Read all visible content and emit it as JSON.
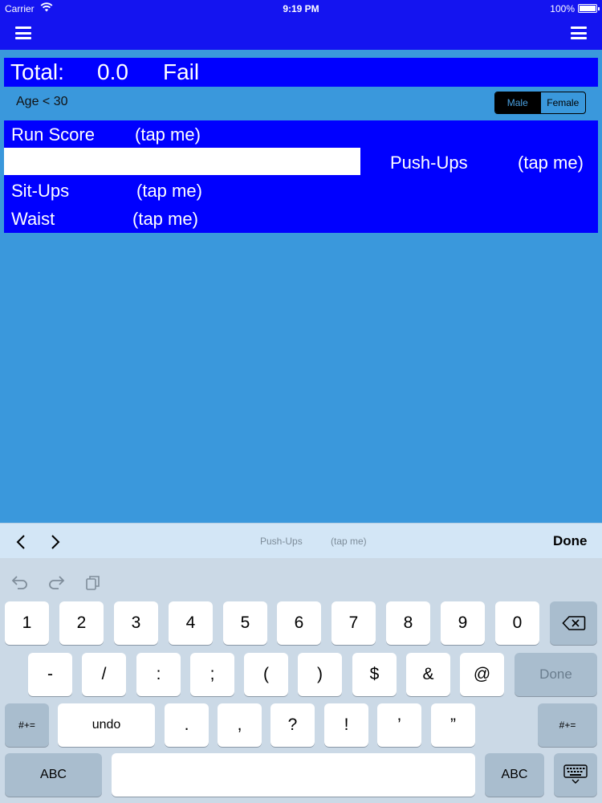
{
  "status_bar": {
    "carrier": "Carrier",
    "time": "9:19 PM",
    "battery": "100%",
    "icons": [
      "wifi-icon",
      "battery-icon"
    ]
  },
  "nav": {
    "left_icon": "hamburger-menu-icon",
    "right_icon": "hamburger-menu-icon"
  },
  "summary": {
    "total_label": "Total:",
    "total_value": "0.0",
    "result": "Fail",
    "age_group": "Age < 30"
  },
  "gender": {
    "options": [
      "Male",
      "Female"
    ],
    "selected": "Male"
  },
  "scores": {
    "run_label": "Run Score",
    "run_hint": "(tap me)",
    "pushups_label": "Push-Ups",
    "pushups_hint": "(tap me)",
    "pushups_value": "",
    "situps_label": "Sit-Ups",
    "situps_hint": "(tap me)",
    "waist_label": "Waist",
    "waist_hint": "(tap me)"
  },
  "accessory": {
    "field_label": "Push-Ups",
    "field_hint": "(tap me)",
    "done": "Done",
    "icons": [
      "chevron-left-icon",
      "chevron-right-icon"
    ]
  },
  "keyboard": {
    "toolbar_icons": [
      "undo-icon",
      "redo-icon",
      "paste-icon"
    ],
    "row1": [
      "1",
      "2",
      "3",
      "4",
      "5",
      "6",
      "7",
      "8",
      "9",
      "0"
    ],
    "row2": [
      "-",
      "/",
      ":",
      ";",
      "(",
      ")",
      "$",
      "&",
      "@"
    ],
    "row2_done": "Done",
    "row3_shift": "#+=",
    "row3_undo": "undo",
    "row3": [
      ".",
      ",",
      "?",
      "!",
      "’",
      "”"
    ],
    "row3_shift_right": "#+=",
    "row4_abc_left": "ABC",
    "row4_abc_right": "ABC",
    "special_icons": [
      "backspace-icon",
      "keyboard-dismiss-icon"
    ]
  }
}
